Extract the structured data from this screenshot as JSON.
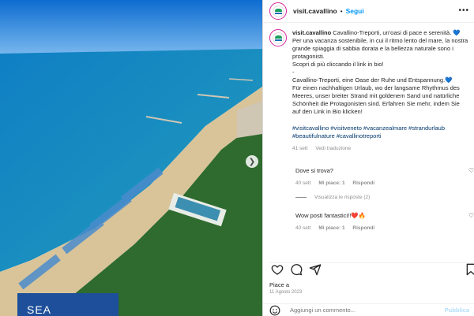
{
  "post": {
    "username": "visit.cavallino",
    "follow_label": "Segui",
    "dot": "•",
    "more": "•••"
  },
  "photo": {
    "overlay_text": "SEA"
  },
  "caption": {
    "username": "visit.cavallino",
    "line1": "Cavallino-Treporti, un'oasi di pace e serenità. 💙",
    "line2": "Per una vacanza sostenibile, in cui il ritmo lento del mare, la nostra grande spiaggia di sabbia dorata e la bellezza naturale sono i protagonisti.",
    "line3": "Scopri di più cliccando il link in bio!",
    "line4": "-",
    "line5": "Cavallino-Treporti, eine Oase der Ruhe und Entspannung.💙",
    "line6": "Für einen nachhaltigen Urlaub, wo der langsame Rhythmus des Meeres, unser breiter Strand mit goldenem Sand und natürliche Schönheit die Protagonisten sind. Erfahren Sie mehr, indem Sie auf den Link in Bio klicken!",
    "hashtags": "#visitcavallino #visitveneto #vacanzealmare #strandurlaub #beautifulnature #cavallinotreporti",
    "time": "41 sett",
    "translate": "Vedi traduzione"
  },
  "comments": [
    {
      "text": "Dove si trova?",
      "time": "40 sett",
      "likes": "Mi piace: 1",
      "reply": "Rispondi"
    },
    {
      "text": "Wow posti fantastici!!❤️🔥",
      "time": "40 sett",
      "likes": "Mi piace: 1",
      "reply": "Rispondi"
    }
  ],
  "replies_label": "Visualizza le risposte (2)",
  "likes_text": "Piace a",
  "date": "11 Agosto 2023",
  "add_comment": {
    "placeholder": "Aggiungi un commento...",
    "post_label": "Pubblica"
  },
  "icons": [
    "heart-icon",
    "comment-icon",
    "share-icon",
    "bookmark-icon",
    "emoji-icon",
    "more-icon",
    "chevron-right-icon"
  ],
  "colors": {
    "accent": "#0095f6",
    "hashtag": "#00376b",
    "sea_tag": "#1d4f9a",
    "muted": "#8e8e8e"
  }
}
